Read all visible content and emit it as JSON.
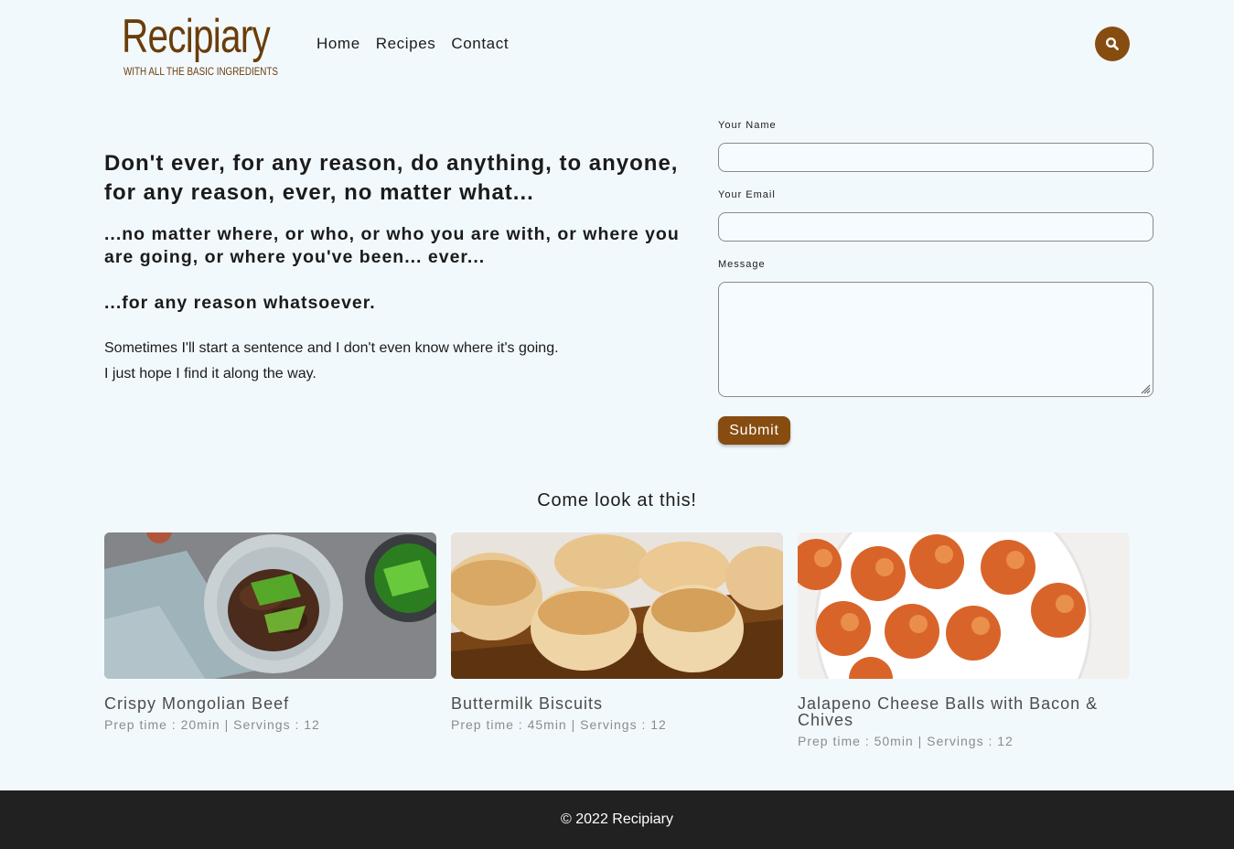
{
  "brand": {
    "name": "Recipiary",
    "tagline": "WITH ALL THE BASIC INGREDIENTS",
    "color": "#874c10"
  },
  "nav": {
    "items": [
      {
        "label": "Home"
      },
      {
        "label": "Recipes"
      },
      {
        "label": "Contact"
      }
    ],
    "search_icon": "search-icon"
  },
  "intro": {
    "heading": "Don't ever, for any reason, do anything, to anyone, for any reason, ever, no matter what...",
    "subheading": "...no matter where, or who, or who you are with, or where you are going, or where you've been... ever...",
    "third": "...for any reason whatsoever.",
    "line1": "Sometimes I'll start a sentence and I don't even know where it's going.",
    "line2": "I just hope I find it along the way."
  },
  "form": {
    "name_label": "Your Name",
    "name_value": "",
    "email_label": "Your Email",
    "email_value": "",
    "message_label": "Message",
    "message_value": "",
    "submit_label": "Submit"
  },
  "showcase": {
    "title": "Come look at this!",
    "cards": [
      {
        "title": "Crispy Mongolian Beef",
        "meta": "Prep time : 20min | Servings : 12"
      },
      {
        "title": "Buttermilk Biscuits",
        "meta": "Prep time : 45min | Servings : 12"
      },
      {
        "title": "Jalapeno Cheese Balls with Bacon & Chives",
        "meta": "Prep time : 50min | Servings : 12"
      }
    ]
  },
  "footer": {
    "text": "© 2022 Recipiary"
  }
}
